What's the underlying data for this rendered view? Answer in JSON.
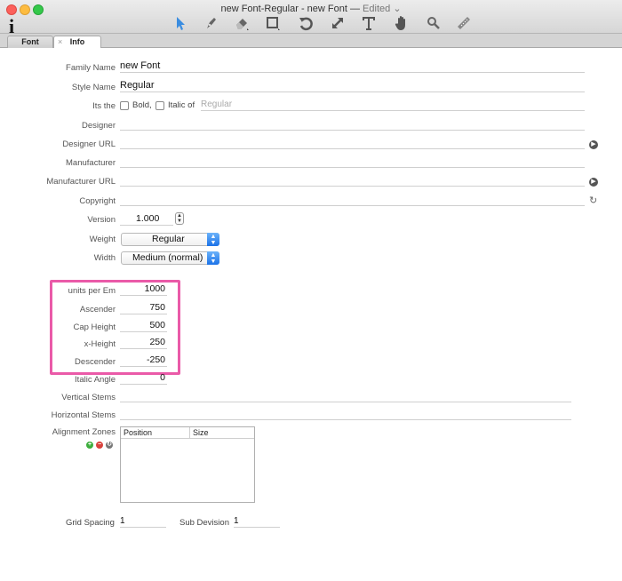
{
  "window": {
    "title": "new Font-Regular - new Font",
    "dash": "—",
    "status": "Edited",
    "status_chevron": "⌄"
  },
  "toolbar": {
    "icons": [
      "select-arrow-icon",
      "pen-icon",
      "eraser-icon",
      "rectangle-icon",
      "rotate-icon",
      "scale-icon",
      "text-icon",
      "hand-icon",
      "zoom-icon",
      "ruler-icon"
    ]
  },
  "tabs": [
    {
      "label": "Font"
    },
    {
      "label": "Info",
      "close": "×"
    }
  ],
  "form": {
    "family_name": {
      "label": "Family Name",
      "value": "new Font"
    },
    "style_name": {
      "label": "Style Name",
      "value": "Regular"
    },
    "its_the": {
      "label": "Its the",
      "bold": "Bold,",
      "italic_of": "Italic of",
      "placeholder": "Regular"
    },
    "designer": {
      "label": "Designer",
      "value": ""
    },
    "designer_url": {
      "label": "Designer URL",
      "value": ""
    },
    "manufacturer": {
      "label": "Manufacturer",
      "value": ""
    },
    "manufacturer_url": {
      "label": "Manufacturer URL",
      "value": ""
    },
    "copyright": {
      "label": "Copyright",
      "value": ""
    },
    "version": {
      "label": "Version",
      "major": "1",
      "dot": ".",
      "minor": "000"
    },
    "weight": {
      "label": "Weight",
      "value": "Regular"
    },
    "width": {
      "label": "Width",
      "value": "Medium (normal)"
    }
  },
  "metrics": {
    "units_per_em": {
      "label": "units per Em",
      "value": "1000"
    },
    "ascender": {
      "label": "Ascender",
      "value": "750"
    },
    "cap_height": {
      "label": "Cap Height",
      "value": "500"
    },
    "x_height": {
      "label": "x-Height",
      "value": "250"
    },
    "descender": {
      "label": "Descender",
      "value": "-250"
    }
  },
  "extra": {
    "italic_angle": {
      "label": "Italic Angle",
      "value": "0"
    },
    "vertical_stems": {
      "label": "Vertical Stems"
    },
    "horizontal_stems": {
      "label": "Horizontal Stems"
    }
  },
  "alignment_zones": {
    "label": "Alignment Zones",
    "columns": [
      "Position",
      "Size"
    ],
    "add": "+",
    "remove": "−",
    "refresh": "↻"
  },
  "grid": {
    "spacing_label": "Grid Spacing",
    "spacing_value": "1",
    "subdivision_label": "Sub Devision",
    "subdivision_value": "1"
  },
  "colors": {
    "highlight": "#ea5aa8",
    "select_accent": "#1b72e8"
  }
}
